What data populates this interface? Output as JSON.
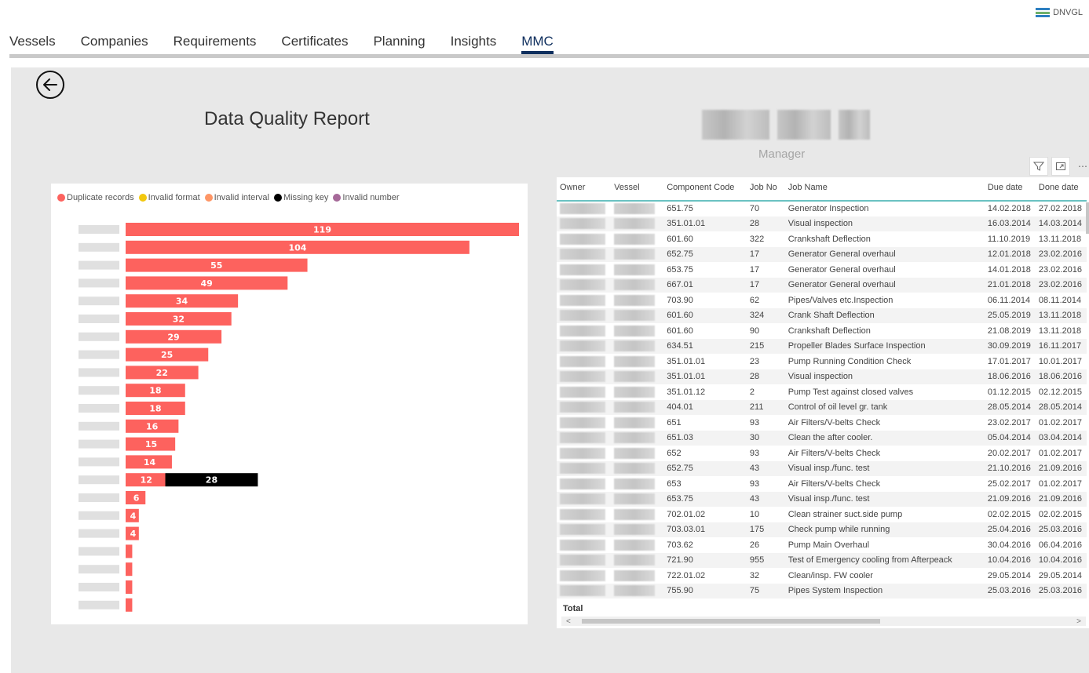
{
  "brand": {
    "label": "DNVGL"
  },
  "nav": {
    "tabs": [
      {
        "label": "Vessels"
      },
      {
        "label": "Companies"
      },
      {
        "label": "Requirements"
      },
      {
        "label": "Certificates"
      },
      {
        "label": "Planning"
      },
      {
        "label": "Insights"
      },
      {
        "label": "MMC"
      }
    ],
    "active_tab": "MMC"
  },
  "report": {
    "title": "Data Quality Report"
  },
  "manager": {
    "label": "Manager"
  },
  "colors": {
    "duplicate": "#fd625e",
    "invalid_format": "#f2c80f",
    "invalid_interval": "#fe9666",
    "missing_key": "#000000",
    "invalid_number": "#a66999",
    "accent": "#0f2f5e"
  },
  "chart_data": {
    "type": "bar",
    "orientation": "horizontal",
    "stacked": true,
    "legend": [
      {
        "name": "Duplicate records",
        "color": "#fd625e"
      },
      {
        "name": "Invalid format",
        "color": "#f2c80f"
      },
      {
        "name": "Invalid interval",
        "color": "#fe9666"
      },
      {
        "name": "Missing key",
        "color": "#000000"
      },
      {
        "name": "Invalid number",
        "color": "#a66999"
      }
    ],
    "xlim": [
      0,
      119
    ],
    "series": [
      {
        "name": "Duplicate records",
        "values": [
          119,
          104,
          55,
          49,
          34,
          32,
          29,
          25,
          22,
          18,
          18,
          16,
          15,
          14,
          12,
          6,
          4,
          4,
          2,
          2,
          2,
          2
        ]
      },
      {
        "name": "Missing key",
        "values": [
          0,
          0,
          0,
          0,
          0,
          0,
          0,
          0,
          0,
          0,
          0,
          0,
          0,
          0,
          28,
          0,
          0,
          0,
          0,
          0,
          0,
          0
        ]
      }
    ],
    "labels_shown": [
      true,
      true,
      true,
      true,
      true,
      true,
      true,
      true,
      true,
      true,
      true,
      true,
      true,
      true,
      true,
      true,
      true,
      true,
      false,
      false,
      false,
      false
    ]
  },
  "table": {
    "columns": [
      "Owner",
      "Vessel",
      "Component Code",
      "Job No",
      "Job Name",
      "Due date",
      "Done date"
    ],
    "rows": [
      [
        "651.75",
        "70",
        "Generator Inspection",
        "14.02.2018",
        "27.02.2018"
      ],
      [
        "351.01.01",
        "28",
        "Visual inspection",
        "16.03.2014",
        "14.03.2014"
      ],
      [
        "601.60",
        "322",
        "Crankshaft Deflection",
        "11.10.2019",
        "13.11.2018"
      ],
      [
        "652.75",
        "17",
        "Generator General overhaul",
        "12.01.2018",
        "23.02.2016"
      ],
      [
        "653.75",
        "17",
        "Generator General overhaul",
        "14.01.2018",
        "23.02.2016"
      ],
      [
        "667.01",
        "17",
        "Generator General overhaul",
        "21.01.2018",
        "23.02.2016"
      ],
      [
        "703.90",
        "62",
        "Pipes/Valves etc.Inspection",
        "06.11.2014",
        "08.11.2014"
      ],
      [
        "601.60",
        "324",
        "Crank Shaft Deflection",
        "25.05.2019",
        "13.11.2018"
      ],
      [
        "601.60",
        "90",
        "Crankshaft Deflection",
        "21.08.2019",
        "13.11.2018"
      ],
      [
        "634.51",
        "215",
        "Propeller Blades Surface Inspection",
        "30.09.2019",
        "16.11.2017"
      ],
      [
        "351.01.01",
        "23",
        "Pump Running Condition Check",
        "17.01.2017",
        "10.01.2017"
      ],
      [
        "351.01.01",
        "28",
        "Visual inspection",
        "18.06.2016",
        "18.06.2016"
      ],
      [
        "351.01.12",
        "2",
        "Pump Test against closed valves",
        "01.12.2015",
        "02.12.2015"
      ],
      [
        "404.01",
        "211",
        "Control of oil level gr. tank",
        "28.05.2014",
        "28.05.2014"
      ],
      [
        "651",
        "93",
        "Air Filters/V-belts Check",
        "23.02.2017",
        "01.02.2017"
      ],
      [
        "651.03",
        "30",
        "Clean the after cooler.",
        "05.04.2014",
        "03.04.2014"
      ],
      [
        "652",
        "93",
        "Air Filters/V-belts Check",
        "20.02.2017",
        "01.02.2017"
      ],
      [
        "652.75",
        "43",
        "Visual insp./func. test",
        "21.10.2016",
        "21.09.2016"
      ],
      [
        "653",
        "93",
        "Air Filters/V-belts Check",
        "25.02.2017",
        "01.02.2017"
      ],
      [
        "653.75",
        "43",
        "Visual insp./func. test",
        "21.09.2016",
        "21.09.2016"
      ],
      [
        "702.01.02",
        "10",
        "Clean strainer suct.side pump",
        "02.02.2015",
        "02.02.2015"
      ],
      [
        "703.03.01",
        "175",
        "Check pump while running",
        "25.04.2016",
        "25.03.2016"
      ],
      [
        "703.62",
        "26",
        "Pump Main Overhaul",
        "30.04.2016",
        "06.04.2016"
      ],
      [
        "721.90",
        "955",
        "Test of Emergency cooling from Afterpeack",
        "10.04.2016",
        "10.04.2016"
      ],
      [
        "722.01.02",
        "32",
        "Clean/insp. FW cooler",
        "29.05.2014",
        "29.05.2014"
      ],
      [
        "755.90",
        "75",
        "Pipes System Inspection",
        "25.03.2016",
        "25.03.2016"
      ]
    ],
    "total_label": "Total"
  }
}
